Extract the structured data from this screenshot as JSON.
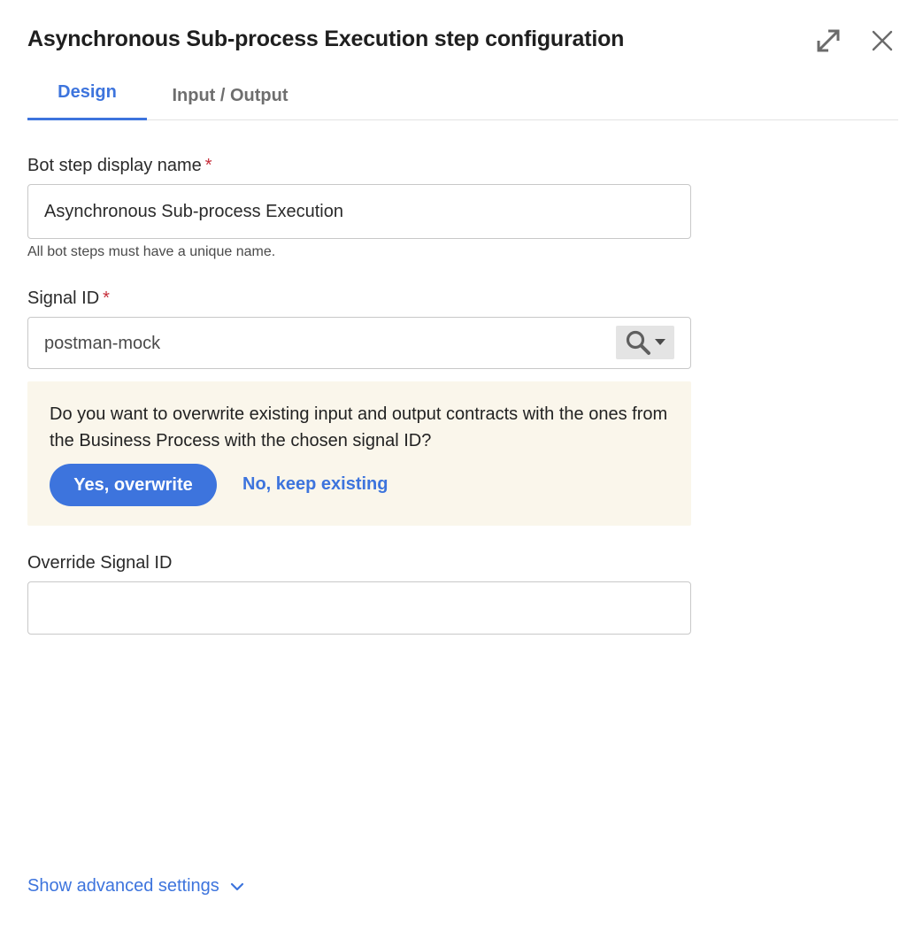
{
  "dialog": {
    "title": "Asynchronous Sub-process Execution step configuration"
  },
  "header_icons": {
    "expand": "expand-icon",
    "close": "close-icon"
  },
  "tabs": [
    {
      "label": "Design",
      "active": true
    },
    {
      "label": "Input / Output",
      "active": false
    }
  ],
  "fields": {
    "display_name": {
      "label": "Bot step display name",
      "required_mark": "*",
      "value": "Asynchronous Sub-process Execution",
      "help": "All bot steps must have a unique name."
    },
    "signal_id": {
      "label": "Signal ID",
      "required_mark": "*",
      "value": "postman-mock",
      "button_icons": [
        "search-icon",
        "caret-down-icon"
      ]
    },
    "override_signal_id": {
      "label": "Override Signal ID",
      "value": ""
    }
  },
  "notice": {
    "message": "Do you want to overwrite existing input and output contracts with the ones from the Business Process with the chosen signal ID?",
    "primary_label": "Yes, overwrite",
    "secondary_label": "No, keep existing"
  },
  "advanced": {
    "label": "Show advanced settings"
  },
  "colors": {
    "accent": "#3d74dd",
    "required": "#c62e3a",
    "notice_bg": "#faf6eb"
  }
}
